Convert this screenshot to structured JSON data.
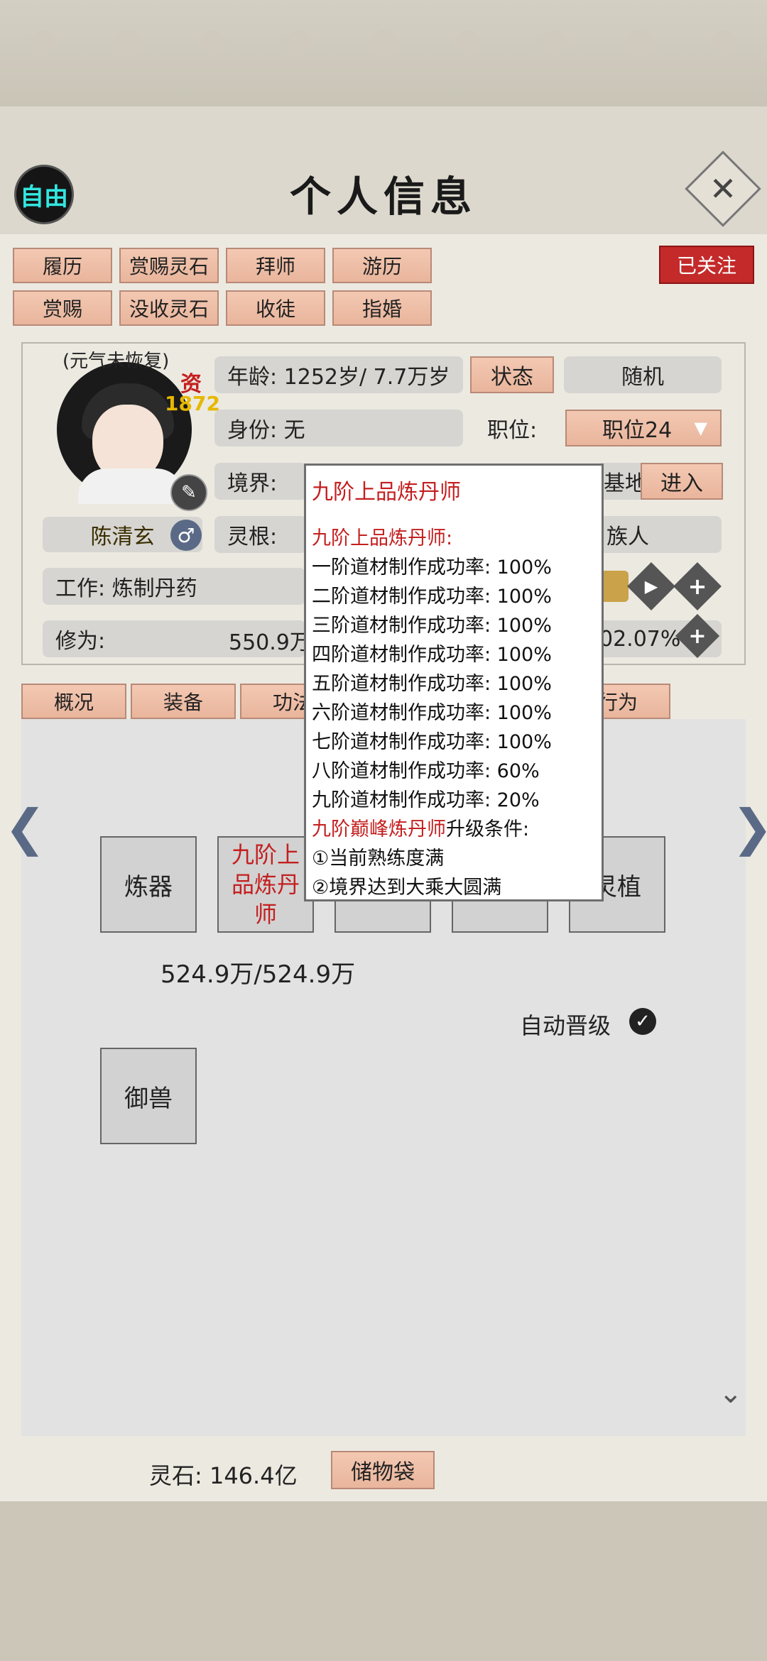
{
  "header": {
    "free_label": "自由",
    "title": "个人信息",
    "close_glyph": "✕"
  },
  "action_buttons": {
    "row1": [
      "履历",
      "赏赐灵石",
      "拜师",
      "游历"
    ],
    "row2": [
      "赏赐",
      "没收灵石",
      "收徒",
      "指婚"
    ],
    "follow_label": "已关注"
  },
  "character": {
    "status_note": "(元气未恢复)",
    "aptitude_label": "资",
    "aptitude_value": "1872",
    "name": "陈清玄",
    "gender_icon": "♂",
    "age": "年龄: 1252岁/ 7.7万岁",
    "status_button": "状态",
    "random_button": "随机",
    "identity": "身份:  无",
    "position_label": "职位:",
    "position_value": "职位24",
    "realm_label": "境界:",
    "realm_suffix": "基地",
    "enter_button": "进入",
    "root_label": "灵根:",
    "clan_suffix": "族人",
    "work": "工作: 炼制丹药",
    "cultivation_label": "修为:",
    "cultivation_value": "550.9万",
    "cultivation_percent": "02.07%"
  },
  "tabs": [
    "概况",
    "装备",
    "功法",
    "行为"
  ],
  "skills": {
    "forge": "炼器",
    "alchemy": "九阶上品炼丹师",
    "plant": "灵植",
    "beast": "御兽",
    "progress": "524.9万/524.9万",
    "auto_upgrade": "自动晋级"
  },
  "tooltip": {
    "title": "九阶上品炼丹师",
    "subtitle": "九阶上品炼丹师:",
    "rates": [
      "一阶道材制作成功率:  100%",
      "二阶道材制作成功率:  100%",
      "三阶道材制作成功率:  100%",
      "四阶道材制作成功率:  100%",
      "五阶道材制作成功率:  100%",
      "六阶道材制作成功率:  100%",
      "七阶道材制作成功率:  100%",
      "八阶道材制作成功率:  60%",
      "九阶道材制作成功率:  20%"
    ],
    "next_rank": "九阶巅峰炼丹师",
    "next_suffix": "升级条件:",
    "cond1": "①当前熟练度满",
    "cond2": "②境界达到大乘大圆满"
  },
  "footer": {
    "spirit_stones": "灵石: 146.4亿",
    "bag_button": "储物袋"
  },
  "colors": {
    "accent_red": "#c42a2a",
    "salmon": "#f3c8b2",
    "teal": "#33e6e0"
  }
}
